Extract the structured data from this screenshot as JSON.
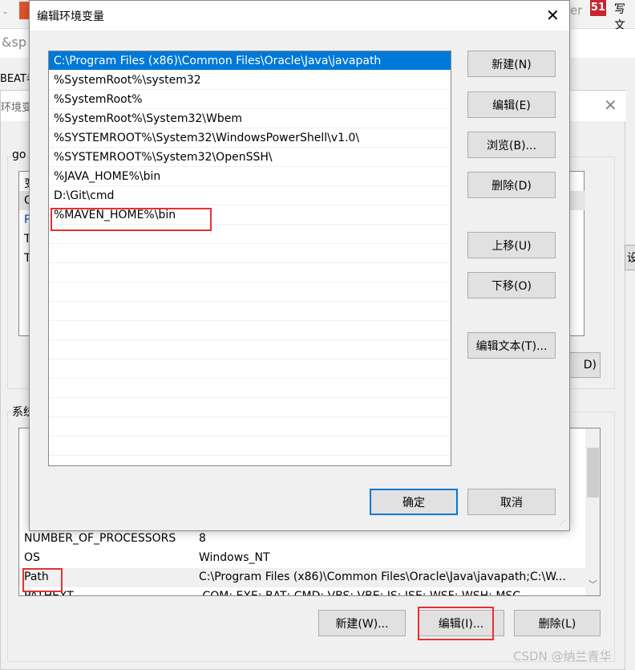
{
  "background": {
    "browser_fragments": [
      "-",
      "er",
      "51",
      "写文",
      "&sp",
      "BEAT老"
    ],
    "env_window": {
      "title_fragment": "环境变",
      "user_group_fragment": "go",
      "system_group_fragment": "系统",
      "user_rows_fragments": [
        "变",
        "O",
        "P",
        "T",
        "T"
      ],
      "system_rows": [
        {
          "name": "NUMBER_OF_PROCESSORS",
          "value": "8"
        },
        {
          "name": "OS",
          "value": "Windows_NT"
        },
        {
          "name": "Path",
          "value": "C:\\Program Files (x86)\\Common Files\\Oracle\\Java\\javapath;C:\\W..."
        },
        {
          "name": "PATHEXT",
          "value": ".COM;.EXE;.BAT;.CMD;.VBS;.VBE;.JS;.JSE;.WSF;.WSH;.MSC"
        }
      ],
      "buttons": {
        "new": "新建(W)...",
        "edit": "编辑(I)...",
        "delete": "删除(L)"
      },
      "side_fragment": "设"
    }
  },
  "dialog": {
    "title": "编辑环境变量",
    "entries": [
      "C:\\Program Files (x86)\\Common Files\\Oracle\\Java\\javapath",
      "%SystemRoot%\\system32",
      "%SystemRoot%",
      "%SystemRoot%\\System32\\Wbem",
      "%SYSTEMROOT%\\System32\\WindowsPowerShell\\v1.0\\",
      "%SYSTEMROOT%\\System32\\OpenSSH\\",
      "%JAVA_HOME%\\bin",
      "D:\\Git\\cmd",
      "%MAVEN_HOME%\\bin"
    ],
    "selected_index": 0,
    "buttons": {
      "new": "新建(N)",
      "edit": "编辑(E)",
      "browse": "浏览(B)...",
      "delete": "删除(D)",
      "up": "上移(U)",
      "down": "下移(O)",
      "edit_text": "编辑文本(T)...",
      "ok": "确定",
      "cancel": "取消"
    }
  },
  "watermark": "CSDN @纳兰青华",
  "colors": {
    "selection": "#0078d7",
    "highlight_box": "#e83030",
    "accent_border": "#0078d7"
  }
}
